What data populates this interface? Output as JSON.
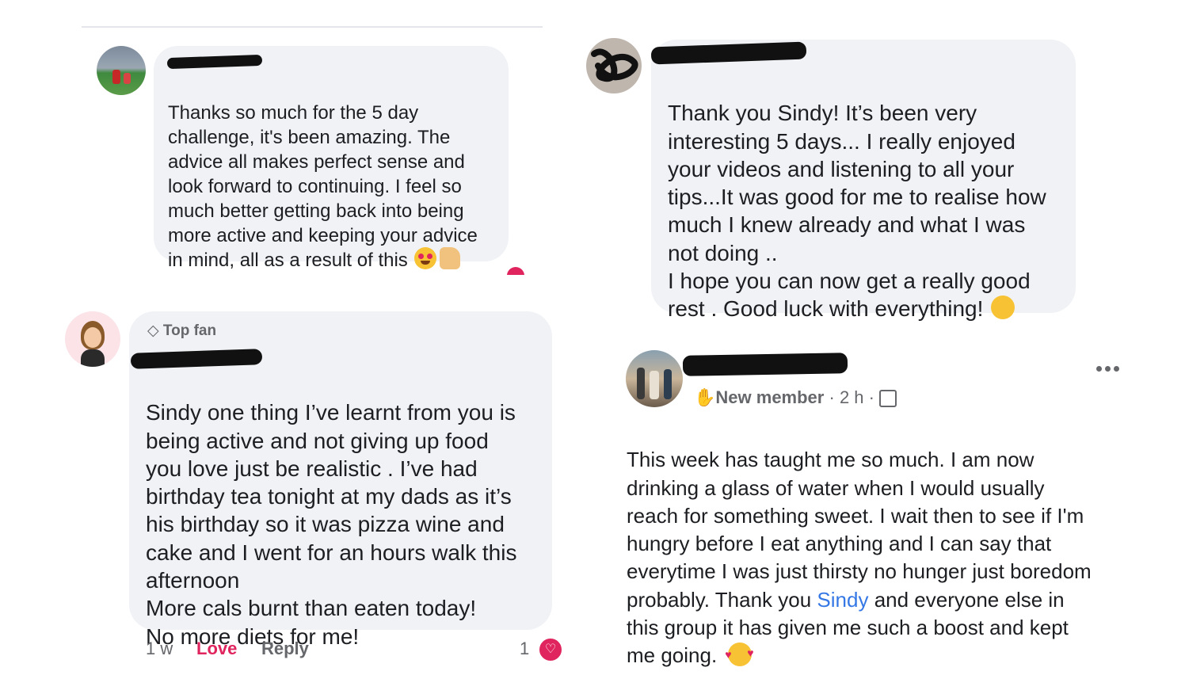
{
  "comments": [
    {
      "badge": "",
      "text": "Thanks so much for the 5 day\nchallenge, it's been amazing. The\nadvice all makes perfect sense and\nlook forward to continuing. I feel so\nmuch better getting back into being\nmore active and keeping your advice\nin mind, all as a result of this",
      "emoji": [
        "heart-eyes-emoji",
        "thumbs-up-emoji"
      ]
    },
    {
      "badge": "",
      "text": "Thank you Sindy! It’s been very\ninteresting 5 days... I really enjoyed\nyour videos and listening to all your\ntips...It was good for me to realise how\nmuch I knew already and what I was\nnot doing ..\nI hope you can now get a really good\nrest . Good luck with everything!",
      "emoji": [
        "smile-emoji"
      ]
    },
    {
      "badge": "Top fan",
      "text": "Sindy one thing I’ve  learnt from you is\nbeing active and not giving up food\nyou love just be realistic . I’ve had\nbirthday tea tonight at my dads as it’s\nhis birthday so it was pizza wine and\ncake and I went for an hours walk this\nafternoon\nMore cals burnt than eaten today!\nNo more diets for me!",
      "meta": {
        "time": "1 w",
        "love": "Love",
        "reply": "Reply",
        "reaction_count": "1"
      }
    },
    {
      "badge": "New member",
      "time": "2 h",
      "text_before": "This week has taught me so much.  I am now\ndrinking a glass of water when I would usually\nreach for something sweet.  I wait then to see if I'm\nhungry before I eat anything and I can say that\neverytime I was just thirsty no hunger just boredom\nprobably.  Thank you ",
      "mention": "Sindy",
      "text_after": " and everyone else in\nthis group it has given me such a boost and kept\nme going.",
      "emoji": [
        "smiling-hearts-emoji"
      ]
    }
  ],
  "colors": {
    "bubble": "#f0f2f5",
    "love": "#e0245e",
    "mention": "#3578e5",
    "meta_text": "#65676b"
  }
}
